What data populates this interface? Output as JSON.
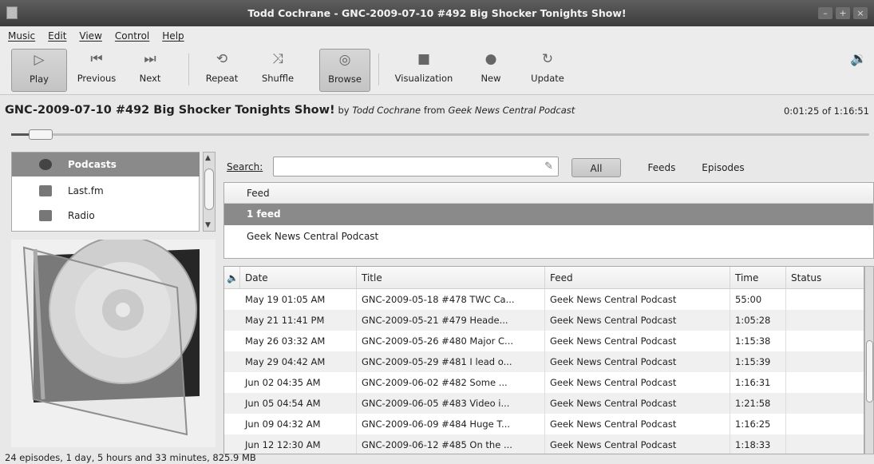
{
  "window": {
    "title": "Todd Cochrane - GNC-2009-07-10 #492 Big Shocker Tonights Show!",
    "buttons": [
      "–",
      "+",
      "×"
    ]
  },
  "menu": [
    "Music",
    "Edit",
    "View",
    "Control",
    "Help"
  ],
  "toolbar": [
    {
      "id": "play",
      "label": "Play",
      "icon": "play-icon",
      "glyph": "▷",
      "pressed": true
    },
    {
      "id": "previous",
      "label": "Previous",
      "icon": "previous-icon",
      "glyph": "⏮"
    },
    {
      "id": "next",
      "label": "Next",
      "icon": "next-icon",
      "glyph": "⏭"
    },
    {
      "id": "repeat",
      "label": "Repeat",
      "icon": "repeat-icon",
      "glyph": "⟲"
    },
    {
      "id": "shuffle",
      "label": "Shuffle",
      "icon": "shuffle-icon",
      "glyph": "⤨"
    },
    {
      "id": "browse",
      "label": "Browse",
      "icon": "browse-icon",
      "glyph": "◎",
      "pressed": true
    },
    {
      "id": "visualization",
      "label": "Visualization",
      "icon": "visualization-icon",
      "glyph": "■"
    },
    {
      "id": "new",
      "label": "New",
      "icon": "new-icon",
      "glyph": "●"
    },
    {
      "id": "update",
      "label": "Update",
      "icon": "update-icon",
      "glyph": "↻"
    }
  ],
  "volume_icon": "volume-icon",
  "now_playing": {
    "title": "GNC-2009-07-10 #492 Big Shocker Tonights Show!",
    "by": "by",
    "artist": "Todd Cochrane",
    "from": "from",
    "album": "Geek News Central Podcast",
    "elapsed": "0:01:25 of 1:16:51",
    "progress_fraction": 0.018
  },
  "sources": [
    {
      "label": "Podcasts",
      "icon": "podcast-icon",
      "selected": true
    },
    {
      "label": "Last.fm",
      "icon": "lastfm-icon"
    },
    {
      "label": "Radio",
      "icon": "radio-icon"
    }
  ],
  "search": {
    "label": "Search:",
    "value": "",
    "filters": [
      "All",
      "Feeds",
      "Episodes"
    ],
    "active_filter": "All"
  },
  "feeds": {
    "header": "Feed",
    "summary": "1 feed",
    "items": [
      "Geek News Central Podcast"
    ]
  },
  "episodes": {
    "headers": [
      "Date",
      "Title",
      "Feed",
      "Time",
      "Status"
    ],
    "rows": [
      [
        "May 19 01:05 AM",
        "GNC-2009-05-18 #478 TWC Ca...",
        "Geek News Central Podcast",
        "55:00",
        ""
      ],
      [
        "May 21 11:41 PM",
        "GNC-2009-05-21 #479 Heade...",
        "Geek News Central Podcast",
        "1:05:28",
        ""
      ],
      [
        "May 26 03:32 AM",
        "GNC-2009-05-26 #480 Major C...",
        "Geek News Central Podcast",
        "1:15:38",
        ""
      ],
      [
        "May 29 04:42 AM",
        "GNC-2009-05-29 #481 I lead o...",
        "Geek News Central Podcast",
        "1:15:39",
        ""
      ],
      [
        "Jun 02 04:35 AM",
        "GNC-2009-06-02 #482 Some ...",
        "Geek News Central Podcast",
        "1:16:31",
        ""
      ],
      [
        "Jun 05 04:54 AM",
        "GNC-2009-06-05 #483 Video i...",
        "Geek News Central Podcast",
        "1:21:58",
        ""
      ],
      [
        "Jun 09 04:32 AM",
        "GNC-2009-06-09 #484 Huge T...",
        "Geek News Central Podcast",
        "1:16:25",
        ""
      ],
      [
        "Jun 12 12:30 AM",
        "GNC-2009-06-12 #485 On the ...",
        "Geek News Central Podcast",
        "1:18:33",
        ""
      ]
    ]
  },
  "status": "24 episodes, 1 day, 5 hours and 33 minutes, 825.9 MB"
}
